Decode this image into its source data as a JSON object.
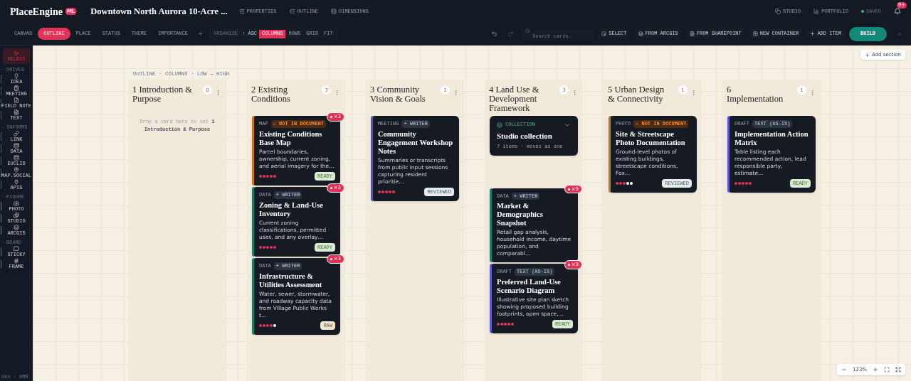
{
  "header": {
    "logo": "PlaceEngine",
    "logo_badge": "ML",
    "project_title": "Downtown North Aurora 10-Acre ...",
    "nav": [
      "PROPERTIES",
      "OUTLINE",
      "DIMENSIONS"
    ],
    "right": [
      "STUDIO",
      "PORTFOLIO"
    ],
    "saved": "SAVED",
    "notifications": "9+"
  },
  "view_tabs": [
    {
      "label": "CANVAS",
      "selected": false
    },
    {
      "label": "OUTLINE",
      "selected": true
    },
    {
      "label": "PLACE",
      "selected": false
    },
    {
      "label": "STATUS",
      "selected": false
    },
    {
      "label": "THEME",
      "selected": false
    },
    {
      "label": "IMPORTANCE",
      "selected": false
    }
  ],
  "add_tab": "+",
  "organize": {
    "label": "ORGANIZE",
    "sort": "↑ ASC",
    "options": [
      {
        "label": "COLUMNS",
        "selected": true
      },
      {
        "label": "ROWS",
        "selected": false
      },
      {
        "label": "GRID",
        "selected": false
      },
      {
        "label": "FIT",
        "selected": false
      }
    ]
  },
  "search": {
    "placeholder": "Search cards…"
  },
  "actions": [
    "SELECT",
    "FROM ARCGIS",
    "FROM SHAREPOINT",
    "NEW CONTAINER",
    "ADD ITEM"
  ],
  "build": "BUILD",
  "sidebar": {
    "select": {
      "label": "SELECT",
      "selected": true
    },
    "groups": [
      {
        "label": "DRIVES",
        "color": "#4a46b8",
        "items": [
          "IDEA",
          "MEETING",
          "FIELD NOTE",
          "TEXT"
        ]
      },
      {
        "label": "INFORMS",
        "color": "#17806d",
        "items": [
          "LINK",
          "DATA",
          "EUCLID",
          "MAP.SOCIAL",
          "APIS"
        ]
      },
      {
        "label": "FIGURE",
        "color": "#b8741c",
        "items": [
          "PHOTO",
          "STUDIO",
          "ARCGIS"
        ]
      },
      {
        "label": "BOARD",
        "color": "#6b7280",
        "items": [
          "STICKY",
          "FRAME"
        ]
      }
    ],
    "footer": "dev · HMR"
  },
  "canvas": {
    "breadcrumb": "OUTLINE · COLUMNS · LOW → HIGH",
    "add_section": "Add section",
    "zoom": "123%",
    "columns": [
      {
        "title": "1 Introduction & Purpose",
        "count": "0",
        "empty_text": "Drop a card here to set **1 Introduction & Purpose**"
      },
      {
        "title": "2 Existing Conditions",
        "count": "3",
        "cards": [
          {
            "kind": "card",
            "type": "MAP",
            "color": "#c9771a",
            "tag": {
              "kind": "warning",
              "label": "⚠ NOT IN DOCUMENT"
            },
            "title": "Existing Conditions Base Map",
            "description": "Parcel boundaries, ownership, current zoning, and aerial imagery for the…",
            "stars": 5,
            "status": {
              "kind": "ready",
              "label": "READY"
            },
            "comments": "×3"
          },
          {
            "kind": "card",
            "type": "DATA",
            "color": "#17806d",
            "tag": {
              "kind": "muted",
              "label": "+ WRITER"
            },
            "title": "Zoning & Land-Use Inventory",
            "description": "Current zoning classifications, permitted uses, and any overlay…",
            "stars": 5,
            "status": {
              "kind": "ready",
              "label": "READY"
            },
            "comments": "×3"
          },
          {
            "kind": "card",
            "type": "DATA",
            "color": "#17806d",
            "tag": {
              "kind": "muted",
              "label": "+ WRITER"
            },
            "title": "Infrastructure & Utilities Assessment",
            "description": "Water, sewer, stormwater, and roadway capacity data from Village Public Works t…",
            "stars": 4,
            "status": {
              "kind": "raw",
              "label": "RAW"
            },
            "comments": "×3"
          }
        ]
      },
      {
        "title": "3 Community Vision & Goals",
        "count": "1",
        "cards": [
          {
            "kind": "card",
            "type": "MEETING",
            "color": "#5b4fc9",
            "tag": {
              "kind": "muted",
              "label": "+ WRITER"
            },
            "title": "Community Engagement Workshop Notes",
            "description": "Summaries or transcripts from public input sessions capturing resident prioritie…",
            "stars": 5,
            "status": {
              "kind": "reviewed",
              "label": "REVIEWED"
            }
          }
        ]
      },
      {
        "title": "4 Land Use & Development Framework",
        "count": "3",
        "cards": [
          {
            "kind": "collection",
            "type": "COLLECTION",
            "title": "Studio collection",
            "description": "7 items · moves as one"
          },
          {
            "kind": "card",
            "type": "DATA",
            "color": "#17806d",
            "tag": {
              "kind": "muted",
              "label": "+ WRITER"
            },
            "title": "Market & Demographics Snapshot",
            "description": "Retail gap analysis, household income, daytime population, and comparabl…",
            "comments": "×9"
          },
          {
            "kind": "card",
            "type": "DRAFT",
            "color": "#5b5bd6",
            "tag": {
              "kind": "muted",
              "label": "TEXT (AS-IS)"
            },
            "title": "Preferred Land-Use Scenario Diagram",
            "description": "Illustrative site plan sketch showing proposed building footprints, open space,…",
            "stars": 5,
            "status": {
              "kind": "ready",
              "label": "READY"
            },
            "comments": "×9"
          }
        ]
      },
      {
        "title": "5 Urban Design & Connectivity",
        "count": "1",
        "cards": [
          {
            "kind": "card",
            "type": "PHOTO",
            "color": "#c9771a",
            "tag": {
              "kind": "warning",
              "label": "⚠ NOT IN DOCUMENT"
            },
            "title": "Site & Streetscape Photo Documentation",
            "description": "Ground-level photos of existing buildings, streetscape conditions, Fox…",
            "stars": 3,
            "status": {
              "kind": "reviewed",
              "label": "REVIEWED"
            }
          }
        ]
      },
      {
        "title": "6 Implementation",
        "count": "1",
        "cards": [
          {
            "kind": "card",
            "type": "DRAFT",
            "color": "#5b5bd6",
            "tag": {
              "kind": "muted",
              "label": "TEXT (AS-IS)"
            },
            "title": "Implementation Action Matrix",
            "description": "Table listing each recommended action, lead responsible party, estimate…",
            "stars": 5,
            "status": {
              "kind": "ready",
              "label": "READY"
            }
          }
        ]
      }
    ]
  }
}
